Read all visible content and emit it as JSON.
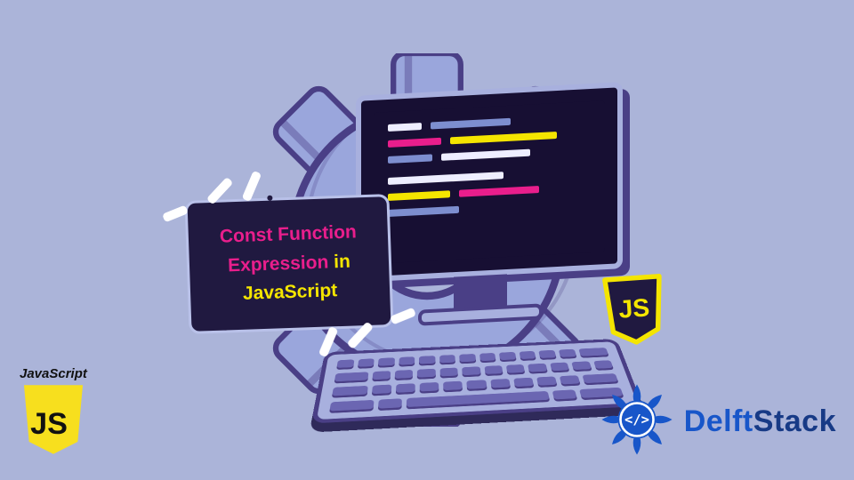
{
  "title": {
    "part1": "Const Function",
    "part2": "Expression",
    "connector": "in",
    "part3": "JavaScript"
  },
  "logos": {
    "js_label": "JavaScript",
    "js_badge_text": "JS",
    "delft_part1": "Delft",
    "delft_part2": "Stack"
  },
  "colors": {
    "background": "#abb4d9",
    "card_bg": "#201940",
    "pink": "#e91e8c",
    "yellow": "#f4e500",
    "gear_light": "#9aa6dc",
    "gear_dark": "#4a3f86",
    "delft_blue": "#1856c9"
  }
}
